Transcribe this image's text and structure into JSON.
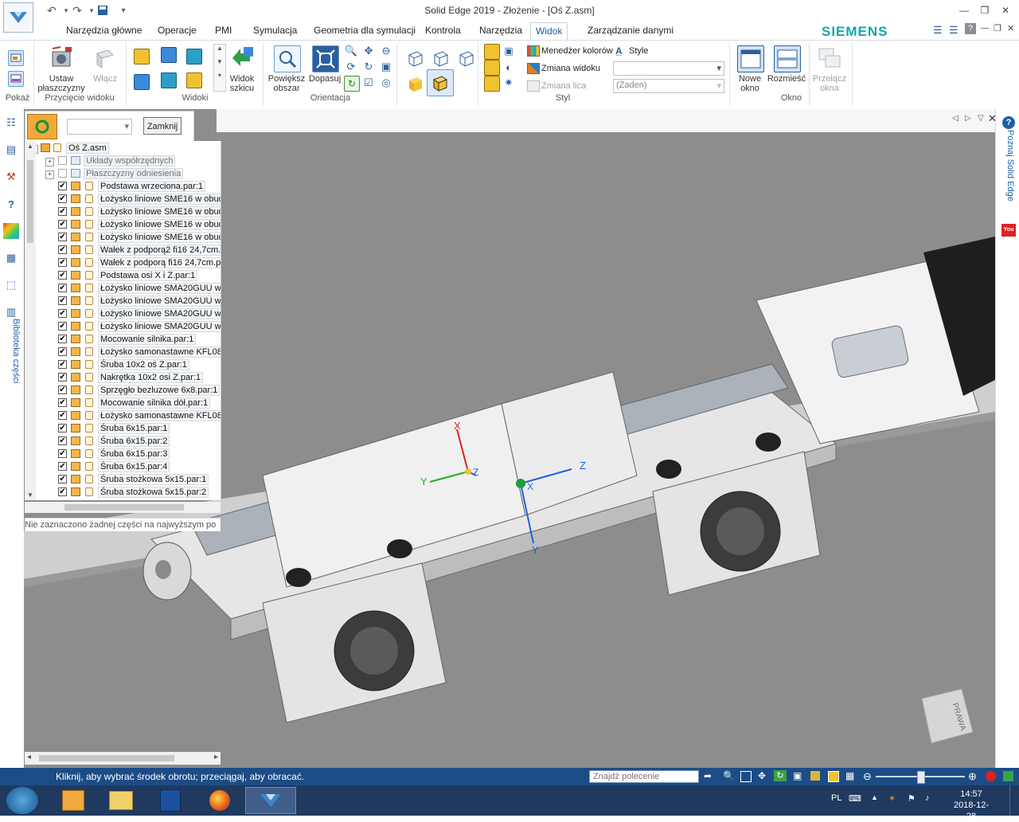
{
  "window": {
    "title": "Solid Edge 2019 - Złożenie - [Oś Z.asm]",
    "brand": "SIEMENS"
  },
  "ribbon": {
    "tabs": [
      {
        "label": "Narzędzia główne"
      },
      {
        "label": "Operacje"
      },
      {
        "label": "PMI"
      },
      {
        "label": "Symulacja"
      },
      {
        "label": "Geometria dla symulacji"
      },
      {
        "label": "Kontrola"
      },
      {
        "label": "Narzędzia"
      },
      {
        "label": "Widok",
        "active": true
      },
      {
        "label": "Zarządzanie danymi"
      }
    ],
    "show_label": "Pokaż",
    "clip_group": {
      "label": "Przycięcie widoku",
      "set_planes": "Ustaw płaszczyzny",
      "enable": "Włącz"
    },
    "views_group": {
      "label": "Widoki",
      "sketch_view": "Widok szkicu"
    },
    "orientation_group": {
      "label": "Orientacja",
      "zoom_area": "Powiększ obszar",
      "fit": "Dopasuj"
    },
    "style_group": {
      "label": "Styl",
      "color_manager": "Menedżer kolorów",
      "style": "Style",
      "view_change": "Zmiana widoku",
      "face_change": "Zmiana lica",
      "style_value": "",
      "face_value": "(Żaden)"
    },
    "window_group": {
      "label": "Okno",
      "new_window": "Nowe okno",
      "arrange": "Rozmieść",
      "switch_windows": "Przełącz okna"
    }
  },
  "pathfinder": {
    "close_button": "Zamknij",
    "root": "Oś Z.asm",
    "folders": [
      "Układy współrzędnych",
      "Płaszczyzny odniesienia"
    ],
    "items": [
      "Podstawa wrzeciona.par:1",
      "Łożysko liniowe SME16 w obud",
      "Łożysko liniowe SME16 w obud",
      "Łożysko liniowe SME16 w obud",
      "Łożysko liniowe SME16 w obud",
      "Wałek z podporą2 fi16 24,7cm.",
      "Wałek z podporą fi16 24,7cm.p",
      "Podstawa osi X i Z.par:1",
      "Łożysko liniowe SMA20GUU w",
      "Łożysko liniowe SMA20GUU w",
      "Łożysko liniowe SMA20GUU w",
      "Łożysko liniowe SMA20GUU w",
      "Mocowanie silnika.par:1",
      "Łożysko samonastawne KFL08.",
      "Śruba 10x2 oś Z.par:1",
      "Nakrętka 10x2 osi Z.par:1",
      "Sprzęgło bezluzowe 6x8.par:1",
      "Mocowanie silnika dół.par:1",
      "Łożysko samonastawne KFL08.",
      "Śruba 6x15.par:1",
      "Śruba 6x15.par:2",
      "Śruba 6x15.par:3",
      "Śruba 6x15.par:4",
      "Śruba stożkowa 5x15.par:1",
      "Śruba stożkowa 5x15.par:2"
    ],
    "status": "Nie zaznaczono żadnej części na najwyższym po"
  },
  "viewport": {
    "axes": {
      "x": "X",
      "y": "Y",
      "z": "Z"
    },
    "view_cube_label": "PRAWA"
  },
  "side": {
    "parts_library": "Biblioteka części",
    "learn": "Poznaj Solid Edge"
  },
  "statusbar": {
    "prompt": "Kliknij, aby wybrać środek obrotu; przeciągaj, aby obracać.",
    "search_placeholder": "Znajdź polecenie"
  },
  "taskbar": {
    "language": "PL",
    "time": "14:57",
    "date": "2018-12-28"
  },
  "colors": {
    "statusbar": "#1c4c86",
    "taskbar": "#20395e",
    "viewport": "#8d8d8d",
    "brand": "#15a6a8",
    "active_tab": "#1b5fa8"
  }
}
